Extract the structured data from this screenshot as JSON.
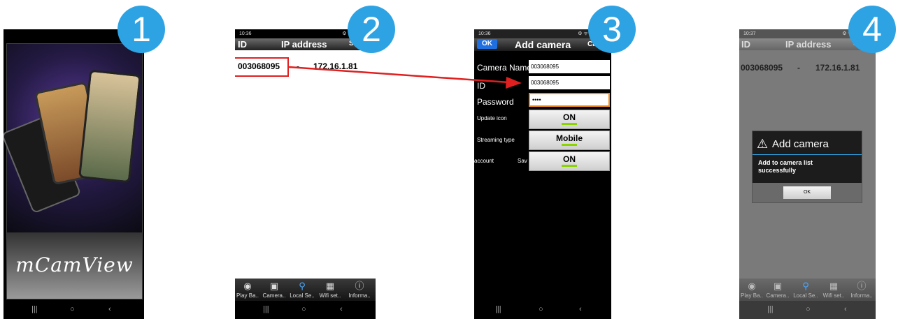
{
  "steps": [
    "1",
    "2",
    "3",
    "4"
  ],
  "splash": {
    "brand": "mCamView"
  },
  "status": {
    "time1": "10:36",
    "time4": "10:37",
    "icons": "⚙ ᯤ .ıl 99%▮"
  },
  "list": {
    "col_id": "ID",
    "col_ip": "IP address",
    "search": "Search",
    "rows": [
      {
        "id": "003068095",
        "sep": "-",
        "ip": "172.16.1.81"
      }
    ]
  },
  "tabs": [
    {
      "label": "Play Ba..",
      "icon": "playback-icon"
    },
    {
      "label": "Camera..",
      "icon": "camera-list-icon"
    },
    {
      "label": "Local Se..",
      "icon": "search-icon"
    },
    {
      "label": "Wifi set..",
      "icon": "qr-icon"
    },
    {
      "label": "Informa..",
      "icon": "info-icon"
    }
  ],
  "add_camera": {
    "ok": "OK",
    "title": "Add camera",
    "cancel": "Cancel",
    "name_label": "Camera Name",
    "name_value": "003068095",
    "id_label": "ID",
    "id_value": "003068095",
    "password_label": "Password",
    "password_value": "••••",
    "update_icon_label": "Update icon",
    "update_icon_value": "ON",
    "streaming_label": "Streaming type",
    "streaming_value": "Mobile",
    "account_label": "account",
    "save_label": "Save",
    "account_value": "ON"
  },
  "dialog": {
    "title": "Add camera",
    "message": "Add to camera list successfully",
    "ok": "OK"
  },
  "colors": {
    "badge": "#2ea3e3",
    "arrow": "#e02020",
    "highlight": "#e02020",
    "toggle_on": "#8bd400",
    "field_focus": "#f08a1c"
  }
}
